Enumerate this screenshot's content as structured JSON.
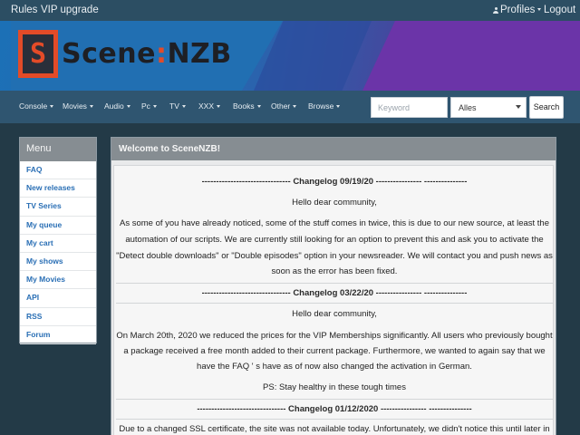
{
  "topbar": {
    "rules": "Rules",
    "vip": "VIP upgrade",
    "profiles": "Profiles",
    "logout": "Logout"
  },
  "logo": {
    "mark": "S",
    "name_a": "Scene",
    "colon": ":",
    "name_b": "NZB"
  },
  "nav": {
    "items": [
      "Console",
      "Movies",
      "Audio",
      "Pc",
      "TV",
      "XXX",
      "Books",
      "Other",
      "Browse"
    ]
  },
  "search": {
    "placeholder": "Keyword",
    "category": "Alles",
    "button": "Search"
  },
  "sidebar": {
    "title": "Menu",
    "items": [
      "FAQ",
      "New releases",
      "TV Series",
      "My queue",
      "My cart",
      "My shows",
      "My Movies",
      "API",
      "RSS",
      "Forum"
    ]
  },
  "main": {
    "title": "Welcome to SceneNZB!",
    "lines": [
      "------------------------------- Changelog 09/19/20 ---------------- ---------------",
      "Hello dear community,",
      "As some of you have already noticed, some of the stuff comes in twice, this is due to our new source, at least the",
      "automation of our scripts. We are currently still looking for an option to prevent this and ask you to activate the",
      "\"Detect double downloads\" or \"Double episodes\" option in your newsreader. We will contact you and push news as",
      "soon as the error has been fixed.",
      "------------------------------- Changelog 03/22/20 ---------------- ---------------",
      "Hello dear community,",
      "On March 20th, 2020 we reduced the prices for the VIP Memberships significantly. All users who previously bought",
      "a package received a free month added to their current package. Furthermore, we wanted to again say that we",
      "have the FAQ ' s have as of now also changed the activation in German.",
      "PS: Stay healthy in these tough times",
      "------------------------------- Changelog 01/12/2020 ---------------- ---------------",
      "Due to a changed SSL certificate, the site was not available today. Unfortunately, we didn't notice this until later in"
    ]
  }
}
